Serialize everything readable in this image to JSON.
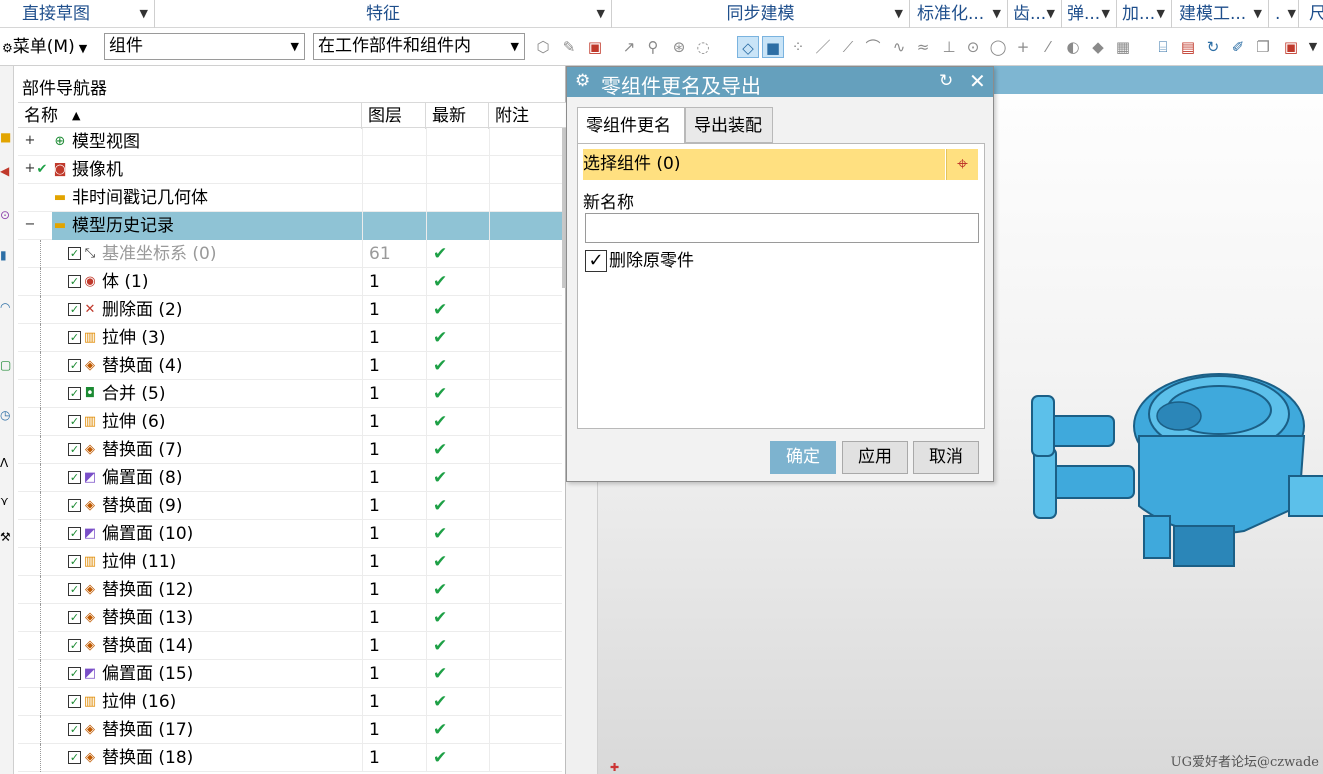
{
  "ribbon_groups": [
    {
      "label": "直接草图"
    },
    {
      "label": "特征"
    },
    {
      "label": "同步建模"
    },
    {
      "label": "标准化..."
    },
    {
      "label": "齿..."
    },
    {
      "label": "弹..."
    },
    {
      "label": "加..."
    },
    {
      "label": "建模工..."
    },
    {
      "label": "."
    },
    {
      "label": "尺"
    }
  ],
  "toolbar": {
    "menu_label": "菜单(M)",
    "filter_value": "组件",
    "scope_value": "在工作部件和组件内"
  },
  "navigator": {
    "title": "部件导航器",
    "columns": {
      "name": "名称",
      "layer": "图层",
      "latest": "最新",
      "note": "附注"
    },
    "rows": [
      {
        "label": "模型视图",
        "layer": "",
        "latest": "",
        "expander": "+",
        "icon": "model-views-icon",
        "indent": 0,
        "checkbox": false,
        "selected": false,
        "grey": false
      },
      {
        "label": "摄像机",
        "layer": "",
        "latest": "",
        "expander": "+",
        "icon": "camera-icon",
        "indent": 0,
        "checkbox": false,
        "selected": false,
        "grey": false
      },
      {
        "label": "非时间戳记几何体",
        "layer": "",
        "latest": "",
        "expander": "",
        "icon": "folder-icon",
        "indent": 0,
        "checkbox": false,
        "selected": false,
        "grey": false
      },
      {
        "label": "模型历史记录",
        "layer": "",
        "latest": "",
        "expander": "−",
        "icon": "folder-open-icon",
        "indent": 0,
        "checkbox": false,
        "selected": true,
        "grey": false
      },
      {
        "label": "基准坐标系 (0)",
        "layer": "61",
        "latest": "✔",
        "icon": "datum-csys-icon",
        "indent": 1,
        "checkbox": true,
        "selected": false,
        "grey": true
      },
      {
        "label": "体 (1)",
        "layer": "1",
        "latest": "✔",
        "icon": "body-icon",
        "indent": 1,
        "checkbox": true,
        "selected": false,
        "grey": false
      },
      {
        "label": "删除面 (2)",
        "layer": "1",
        "latest": "✔",
        "icon": "delete-face-icon",
        "indent": 1,
        "checkbox": true,
        "selected": false,
        "grey": false
      },
      {
        "label": "拉伸 (3)",
        "layer": "1",
        "latest": "✔",
        "icon": "extrude-icon",
        "indent": 1,
        "checkbox": true,
        "selected": false,
        "grey": false
      },
      {
        "label": "替换面 (4)",
        "layer": "1",
        "latest": "✔",
        "icon": "replace-face-icon",
        "indent": 1,
        "checkbox": true,
        "selected": false,
        "grey": false
      },
      {
        "label": "合并 (5)",
        "layer": "1",
        "latest": "✔",
        "icon": "unite-icon",
        "indent": 1,
        "checkbox": true,
        "selected": false,
        "grey": false
      },
      {
        "label": "拉伸 (6)",
        "layer": "1",
        "latest": "✔",
        "icon": "extrude-icon",
        "indent": 1,
        "checkbox": true,
        "selected": false,
        "grey": false
      },
      {
        "label": "替换面 (7)",
        "layer": "1",
        "latest": "✔",
        "icon": "replace-face-icon",
        "indent": 1,
        "checkbox": true,
        "selected": false,
        "grey": false
      },
      {
        "label": "偏置面 (8)",
        "layer": "1",
        "latest": "✔",
        "icon": "offset-face-icon",
        "indent": 1,
        "checkbox": true,
        "selected": false,
        "grey": false
      },
      {
        "label": "替换面 (9)",
        "layer": "1",
        "latest": "✔",
        "icon": "replace-face-icon",
        "indent": 1,
        "checkbox": true,
        "selected": false,
        "grey": false
      },
      {
        "label": "偏置面 (10)",
        "layer": "1",
        "latest": "✔",
        "icon": "offset-face-icon",
        "indent": 1,
        "checkbox": true,
        "selected": false,
        "grey": false
      },
      {
        "label": "拉伸 (11)",
        "layer": "1",
        "latest": "✔",
        "icon": "extrude-icon",
        "indent": 1,
        "checkbox": true,
        "selected": false,
        "grey": false
      },
      {
        "label": "替换面 (12)",
        "layer": "1",
        "latest": "✔",
        "icon": "replace-face-icon",
        "indent": 1,
        "checkbox": true,
        "selected": false,
        "grey": false
      },
      {
        "label": "替换面 (13)",
        "layer": "1",
        "latest": "✔",
        "icon": "replace-face-icon",
        "indent": 1,
        "checkbox": true,
        "selected": false,
        "grey": false
      },
      {
        "label": "替换面 (14)",
        "layer": "1",
        "latest": "✔",
        "icon": "replace-face-icon",
        "indent": 1,
        "checkbox": true,
        "selected": false,
        "grey": false
      },
      {
        "label": "偏置面 (15)",
        "layer": "1",
        "latest": "✔",
        "icon": "offset-face-icon",
        "indent": 1,
        "checkbox": true,
        "selected": false,
        "grey": false
      },
      {
        "label": "拉伸 (16)",
        "layer": "1",
        "latest": "✔",
        "icon": "extrude-icon",
        "indent": 1,
        "checkbox": true,
        "selected": false,
        "grey": false
      },
      {
        "label": "替换面 (17)",
        "layer": "1",
        "latest": "✔",
        "icon": "replace-face-icon",
        "indent": 1,
        "checkbox": true,
        "selected": false,
        "grey": false
      },
      {
        "label": "替换面 (18)",
        "layer": "1",
        "latest": "✔",
        "icon": "replace-face-icon",
        "indent": 1,
        "checkbox": true,
        "selected": false,
        "grey": false
      }
    ]
  },
  "dialog": {
    "title": "零组件更名及导出",
    "tabs": [
      {
        "label": "零组件更名"
      },
      {
        "label": "导出装配"
      }
    ],
    "select_component_label": "选择组件 (0)",
    "new_name_label": "新名称",
    "new_name_value": "",
    "delete_original_label": "删除原零件",
    "delete_original_checked": true,
    "buttons": {
      "ok": "确定",
      "apply": "应用",
      "cancel": "取消"
    }
  },
  "viewport": {
    "watermark": "UG爱好者论坛@czwade"
  },
  "colors": {
    "ribbon_text": "#1f4f8c",
    "dialog_title_bg": "#65a0bd",
    "selection_bar": "#ffe080",
    "selected_row": "#8fc3d5",
    "model_blue": "#3fa9dc",
    "check_green": "#1ea046"
  }
}
